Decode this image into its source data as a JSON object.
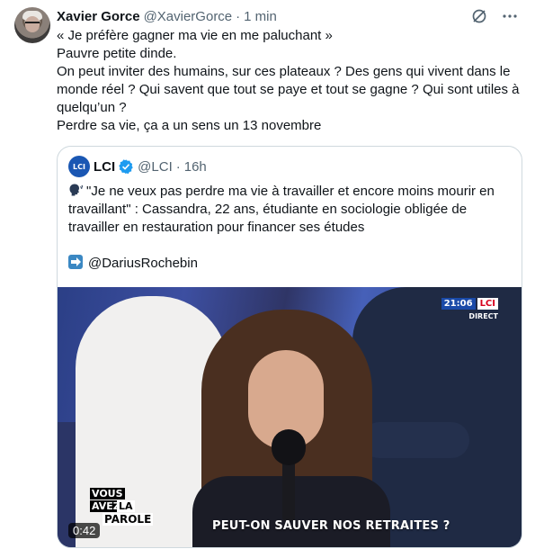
{
  "tweet": {
    "author_name": "Xavier Gorce",
    "author_handle": "@XavierGorce",
    "separator": "·",
    "time": "1 min",
    "lines": [
      "« Je préfère gagner ma vie en me paluchant »",
      "Pauvre petite dinde.",
      "On peut inviter des humains, sur ces plateaux ? Des gens qui vivent dans le monde réel ? Qui savent que tout se paye et tout se gagne ? Qui sont utiles à quelqu’un ?",
      "Perdre sa vie, ça a un sens un 13 novembre"
    ]
  },
  "icons": {
    "avatar": "avatar",
    "grok": "slash-circle-icon",
    "more": "more-icon",
    "verified": "verified-badge-icon",
    "speaking": "speaking-head-icon",
    "arrow": "right-arrow-icon"
  },
  "quote": {
    "logo_text": "LCI",
    "author_name": "LCI",
    "author_handle": "@LCI",
    "separator": "·",
    "time": "16h",
    "text": "\"Je ne veux pas perdre ma vie à travailler et encore moins mourir en travaillant\" : Cassandra, 22 ans, étudiante en sociologie obligée de travailler en restauration pour financer ses études",
    "mention": "@DariusRochebin",
    "media": {
      "clock": "21:06",
      "channel": "LCI",
      "live": "DIRECT",
      "banner": "PEUT-ON SAUVER NOS RETRAITES ?",
      "show_logo": [
        "VOUS",
        "AVEZ",
        "LA",
        "PAROLE"
      ],
      "duration": "0:42"
    }
  },
  "colors": {
    "text": "#0f1419",
    "secondary": "#536471",
    "border": "#cfd9de",
    "verified": "#1d9bf0",
    "lci_blue": "#1a4aa8"
  }
}
